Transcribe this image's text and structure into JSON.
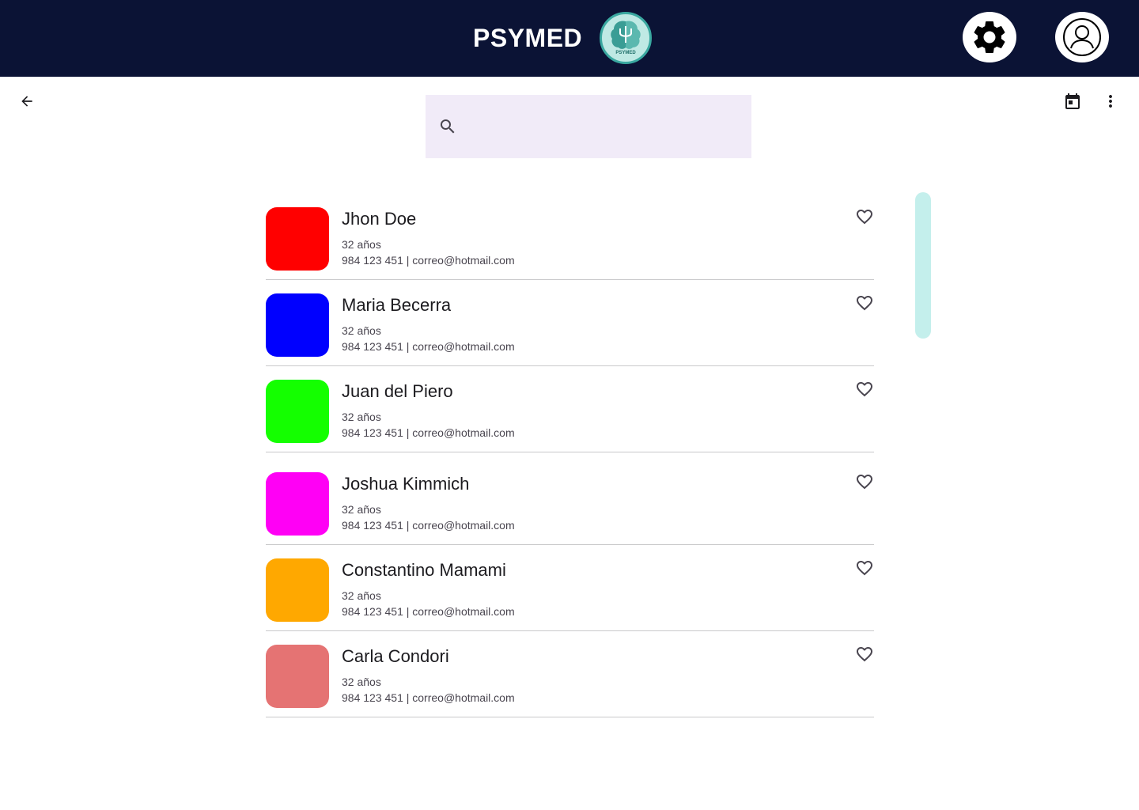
{
  "header": {
    "title": "PSYMED",
    "logo_text": "PSYMED",
    "logo_icon": "brain-psi-logo",
    "settings_icon": "gear-icon",
    "profile_icon": "user-avatar-icon",
    "background_color": "#0b1335"
  },
  "toolbar": {
    "back_icon": "arrow-back-icon",
    "calendar_icon": "calendar-icon",
    "more_icon": "more-vertical-icon"
  },
  "search": {
    "icon": "search-icon",
    "value": "",
    "background_color": "#f1ebf8"
  },
  "patients": [
    {
      "name": "Jhon Doe",
      "age": "32 años",
      "contact": "984 123 451  |  correo@hotmail.com",
      "color": "#ff0000",
      "favorite": false
    },
    {
      "name": "Maria Becerra",
      "age": "32 años",
      "contact": "984 123 451  |  correo@hotmail.com",
      "color": "#0000ff",
      "favorite": false
    },
    {
      "name": "Juan del Piero",
      "age": "32 años",
      "contact": "984 123 451  |  correo@hotmail.com",
      "color": "#14ff00",
      "favorite": false
    },
    {
      "name": "Joshua Kimmich",
      "age": "32 años",
      "contact": "984 123 451  |  correo@hotmail.com",
      "color": "#ff00f5",
      "favorite": false
    },
    {
      "name": "Constantino Mamami",
      "age": "32 años",
      "contact": "984 123 451  |  correo@hotmail.com",
      "color": "#ffa800",
      "favorite": false
    },
    {
      "name": "Carla Condori",
      "age": "32 años",
      "contact": "984 123 451  |  correo@hotmail.com",
      "color": "#e57373",
      "favorite": false
    }
  ],
  "scrollbar": {
    "color": "#c4efec"
  }
}
